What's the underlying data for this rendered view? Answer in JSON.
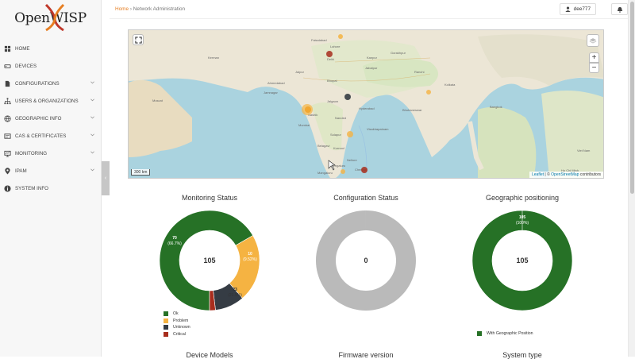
{
  "brand": {
    "logo_text": "OpenWISP"
  },
  "sidebar": {
    "items": [
      {
        "label": "HOME",
        "icon": "home-grid-icon",
        "chevron": false
      },
      {
        "label": "DEVICES",
        "icon": "devices-icon",
        "chevron": false
      },
      {
        "label": "CONFIGURATIONS",
        "icon": "file-icon",
        "chevron": true
      },
      {
        "label": "USERS & ORGANIZATIONS",
        "icon": "org-tree-icon",
        "chevron": true
      },
      {
        "label": "GEOGRAPHIC INFO",
        "icon": "globe-icon",
        "chevron": true
      },
      {
        "label": "CAS & CERTIFICATES",
        "icon": "certificate-icon",
        "chevron": true
      },
      {
        "label": "MONITORING",
        "icon": "monitor-icon",
        "chevron": true
      },
      {
        "label": "IPAM",
        "icon": "pin-icon",
        "chevron": true
      },
      {
        "label": "SYSTEM INFO",
        "icon": "info-icon",
        "chevron": false
      }
    ]
  },
  "breadcrumb": {
    "home": "Home",
    "separator": "›",
    "current": "Network Administration"
  },
  "user": {
    "name": "dee777"
  },
  "map": {
    "scale_label": "300 km",
    "attribution_leaflet": "Leaflet",
    "attribution_sep": " | © ",
    "attribution_osm": "OpenStreetMap",
    "attribution_tail": " contributors",
    "zoom_in": "+",
    "zoom_out": "−"
  },
  "charts": {
    "monitoring": {
      "title": "Monitoring Status",
      "total": "105",
      "legend": [
        {
          "label": "Ok",
          "color": "#267126"
        },
        {
          "label": "Problem",
          "color": "#f5b342"
        },
        {
          "label": "Unknown",
          "color": "#353c44"
        },
        {
          "label": "Critical",
          "color": "#a72d1d"
        }
      ],
      "labels": {
        "ok_count": "70",
        "ok_pct": "(66.7%)",
        "problem_count": "23",
        "problem_pct": "(21.9%)",
        "unknown_count": "10",
        "unknown_pct": "(9.52%)"
      }
    },
    "configuration": {
      "title": "Configuration Status",
      "total": "0"
    },
    "geographic": {
      "title": "Geographic positioning",
      "total": "105",
      "top_count": "105",
      "top_pct": "(100%)",
      "legend": [
        {
          "label": "With Geographic Position",
          "color": "#267126"
        }
      ]
    }
  },
  "next_row_titles": {
    "models": "Device Models",
    "firmware": "Firmware version",
    "system": "System type"
  },
  "chart_data": [
    {
      "type": "pie",
      "title": "Monitoring Status",
      "categories": [
        "Ok",
        "Problem",
        "Unknown",
        "Critical"
      ],
      "values": [
        70,
        23,
        10,
        2
      ],
      "colors": [
        "#267126",
        "#f5b342",
        "#353c44",
        "#a72d1d"
      ]
    },
    {
      "type": "pie",
      "title": "Configuration Status",
      "categories": [],
      "values": []
    },
    {
      "type": "pie",
      "title": "Geographic positioning",
      "categories": [
        "With Geographic Position"
      ],
      "values": [
        105
      ],
      "colors": [
        "#267126"
      ]
    }
  ]
}
